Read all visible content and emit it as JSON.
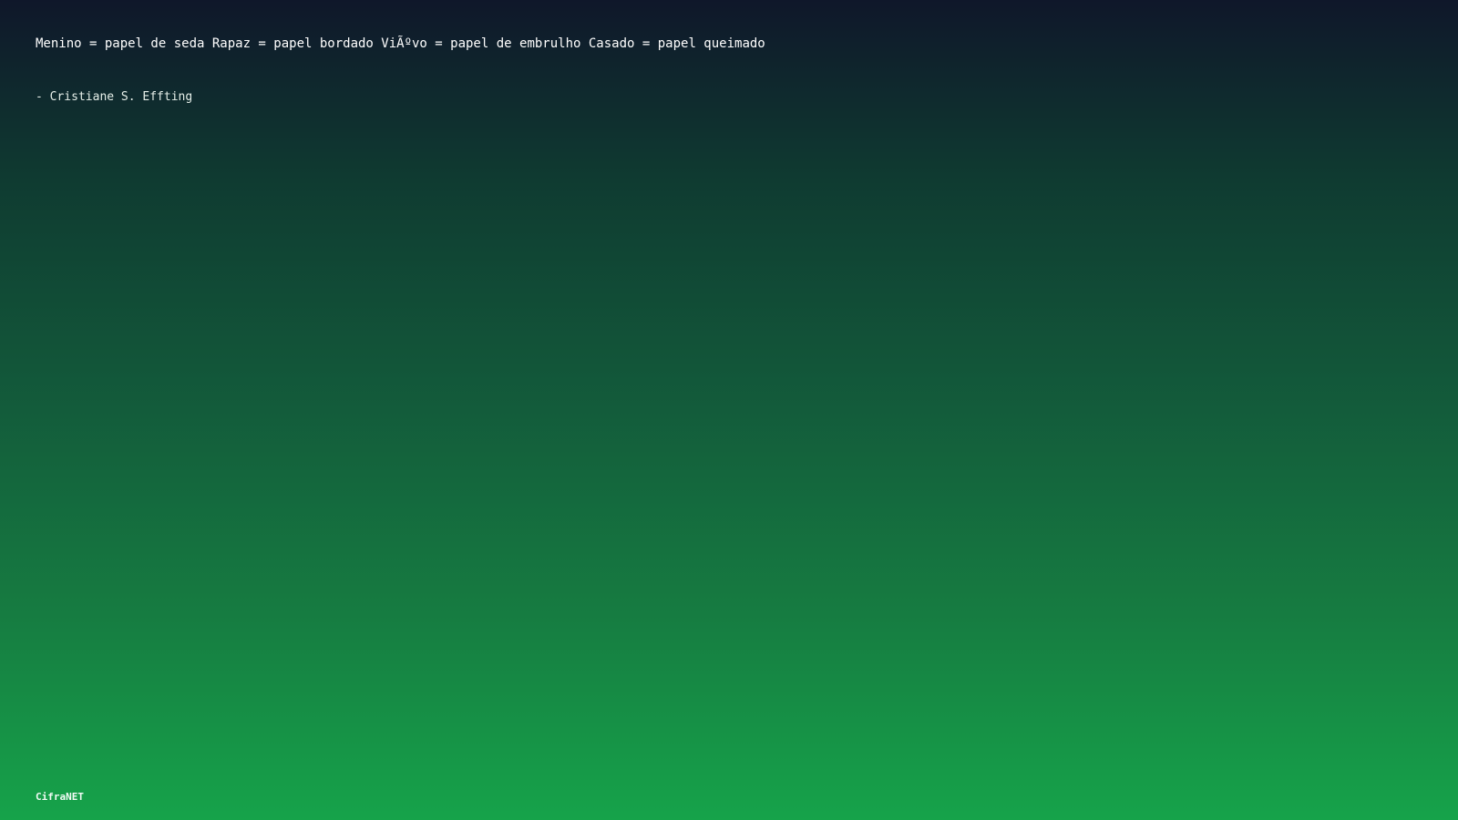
{
  "quote": {
    "text": "Menino = papel de seda Rapaz = papel bordado ViÃºvo = papel de embrulho Casado = papel queimado",
    "author": "- Cristiane S. Effting"
  },
  "footer": {
    "brand": "CifraNET"
  },
  "colors": {
    "gradient_top": "#0f172a",
    "gradient_bottom": "#16a34a",
    "text": "#ffffff"
  }
}
